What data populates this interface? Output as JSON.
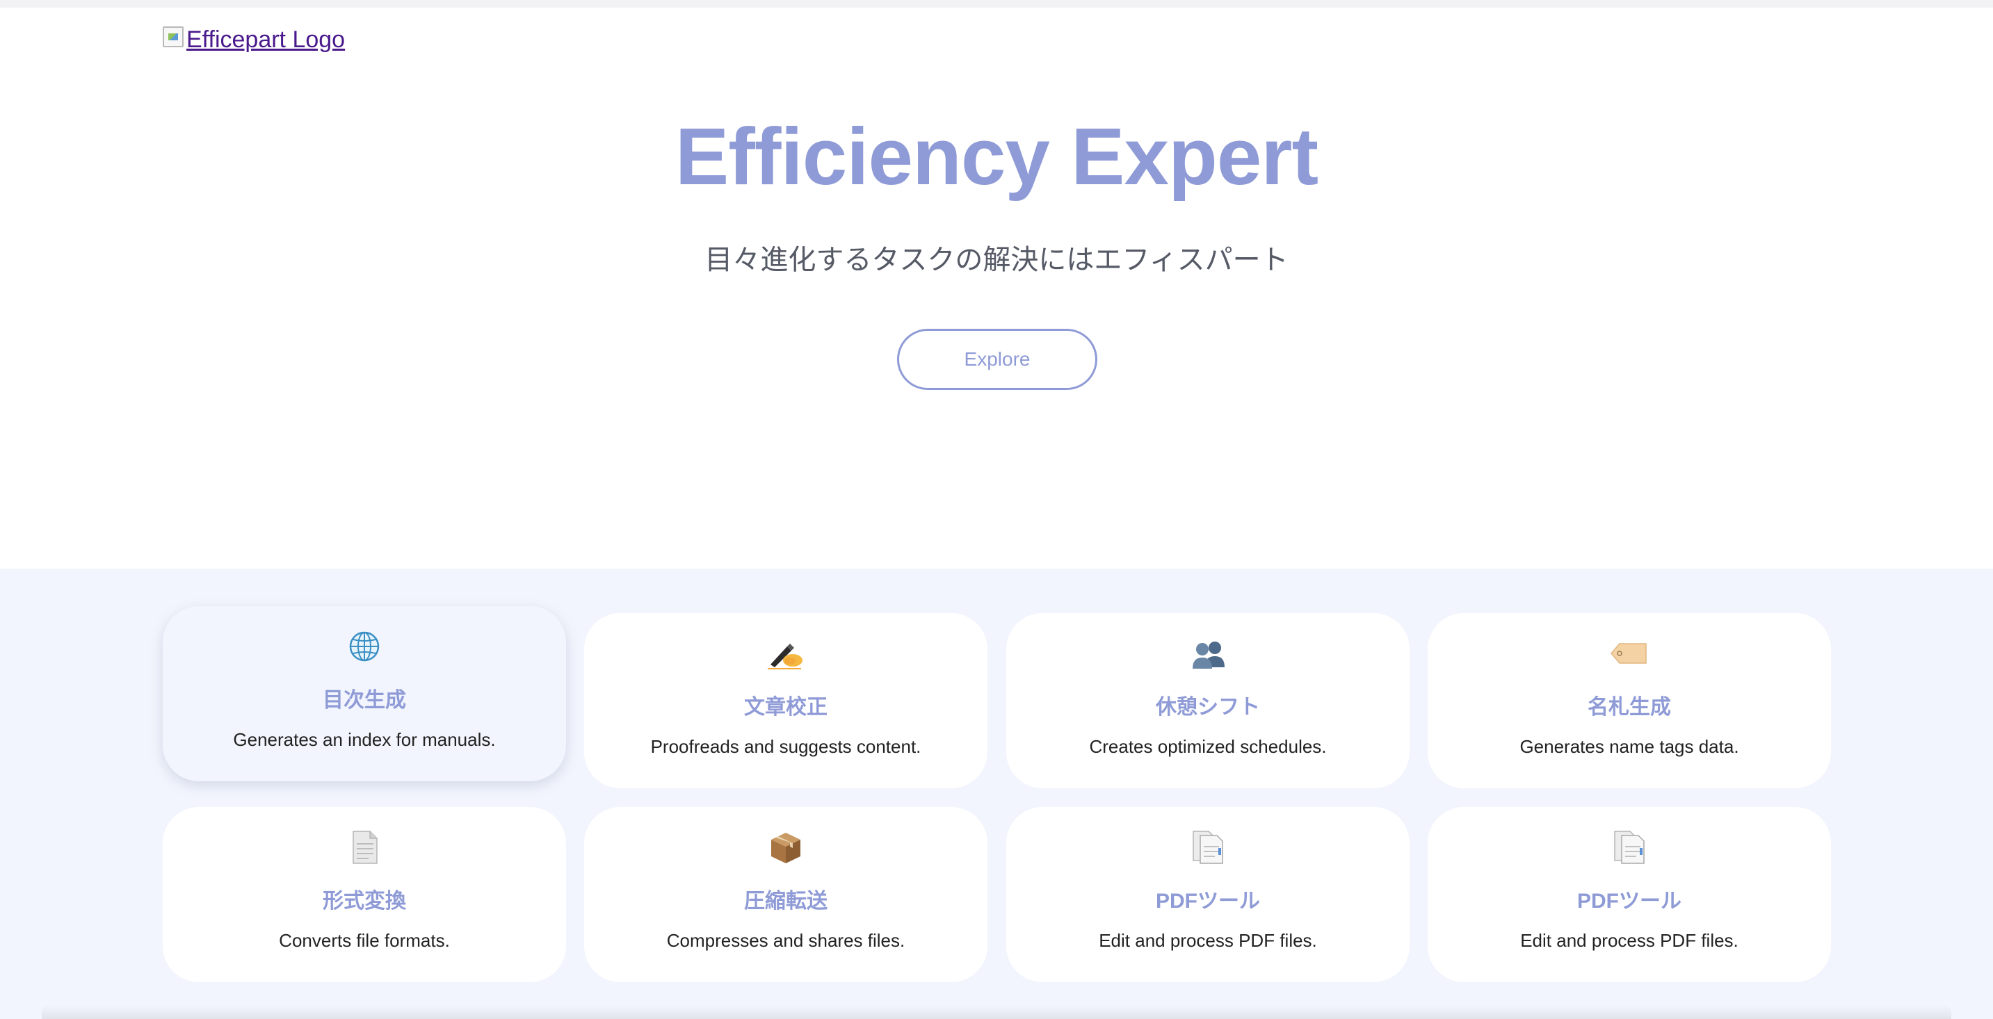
{
  "logo": {
    "alt": "Efficepart Logo"
  },
  "hero": {
    "title": "Efficiency Expert",
    "subtitle": "目々進化するタスクの解決にはエフィスパート",
    "explore_label": "Explore"
  },
  "colors": {
    "accent": "#8f9bd6",
    "section_bg": "#f2f5fd",
    "card_bg": "#ffffff",
    "text": "#222222"
  },
  "tools": [
    {
      "icon": "globe-icon",
      "title": "目次生成",
      "desc": "Generates an index for manuals."
    },
    {
      "icon": "writing-hand-icon",
      "title": "文章校正",
      "desc": "Proofreads and suggests content."
    },
    {
      "icon": "people-icon",
      "title": "休憩シフト",
      "desc": "Creates optimized schedules."
    },
    {
      "icon": "tag-icon",
      "title": "名札生成",
      "desc": "Generates name tags data."
    },
    {
      "icon": "document-icon",
      "title": "形式変換",
      "desc": "Converts file formats."
    },
    {
      "icon": "package-icon",
      "title": "圧縮転送",
      "desc": "Compresses and shares files."
    },
    {
      "icon": "pdf-document-icon",
      "title": "PDFツール",
      "desc": "Edit and process PDF files."
    },
    {
      "icon": "pdf-document-icon",
      "title": "PDFツール",
      "desc": "Edit and process PDF files."
    }
  ]
}
